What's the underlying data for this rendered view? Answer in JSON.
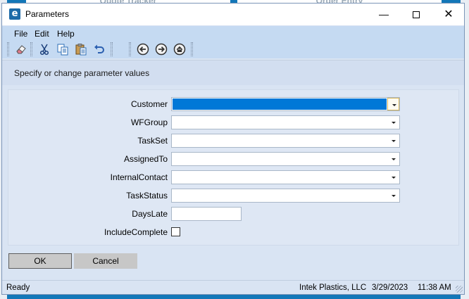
{
  "background": {
    "tab1": "Quote Tracker",
    "tab2": "Order Entry"
  },
  "window": {
    "title": "Parameters",
    "icon": "epicor-e-icon",
    "controls": {
      "minimize": "—",
      "close": "✕"
    }
  },
  "menu": {
    "items": [
      "File",
      "Edit",
      "Help"
    ]
  },
  "toolbar": {
    "icons": [
      "eraser-icon",
      "cut-icon",
      "copy-icon",
      "paste-icon",
      "undo-icon",
      "back-icon",
      "forward-icon",
      "home-icon"
    ]
  },
  "header": {
    "text": "Specify or change parameter values"
  },
  "form": {
    "fields": [
      {
        "label": "Customer",
        "type": "combo",
        "value": "",
        "selected": true
      },
      {
        "label": "WFGroup",
        "type": "combo",
        "value": ""
      },
      {
        "label": "TaskSet",
        "type": "combo",
        "value": ""
      },
      {
        "label": "AssignedTo",
        "type": "combo",
        "value": ""
      },
      {
        "label": "InternalContact",
        "type": "combo",
        "value": ""
      },
      {
        "label": "TaskStatus",
        "type": "combo",
        "value": ""
      },
      {
        "label": "DaysLate",
        "type": "text",
        "value": ""
      },
      {
        "label": "IncludeComplete",
        "type": "checkbox",
        "checked": false
      }
    ]
  },
  "buttons": {
    "ok": "OK",
    "cancel": "Cancel"
  },
  "status": {
    "state": "Ready",
    "company": "Intek Plastics, LLC",
    "date": "3/29/2023",
    "time": "11:38 AM"
  },
  "colors": {
    "selection": "#0078d7",
    "window_bg": "#d9e4f3",
    "menu_bg": "#c5daf2"
  }
}
